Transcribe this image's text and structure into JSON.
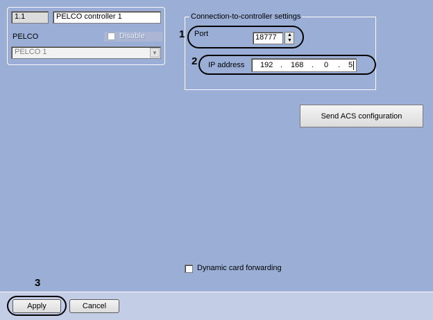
{
  "object": {
    "id": "1.1",
    "name": "PELCO controller 1",
    "type": "PELCO",
    "disable_label": "Disable",
    "parent_value": "PELCO 1"
  },
  "connection": {
    "group_title": "Connection-to-controller settings",
    "port_label": "Port",
    "port_value": "18777",
    "ip_label": "IP address",
    "ip_octets": [
      "192",
      "168",
      "0",
      "5"
    ]
  },
  "actions": {
    "send_acs_label": "Send ACS configuration",
    "dynamic_card_label": "Dynamic card forwarding"
  },
  "footer": {
    "apply_label": "Apply",
    "cancel_label": "Cancel"
  },
  "callouts": {
    "one": "1",
    "two": "2",
    "three": "3"
  },
  "colors": {
    "background": "#9aaed6",
    "footer": "#c3cde6"
  }
}
